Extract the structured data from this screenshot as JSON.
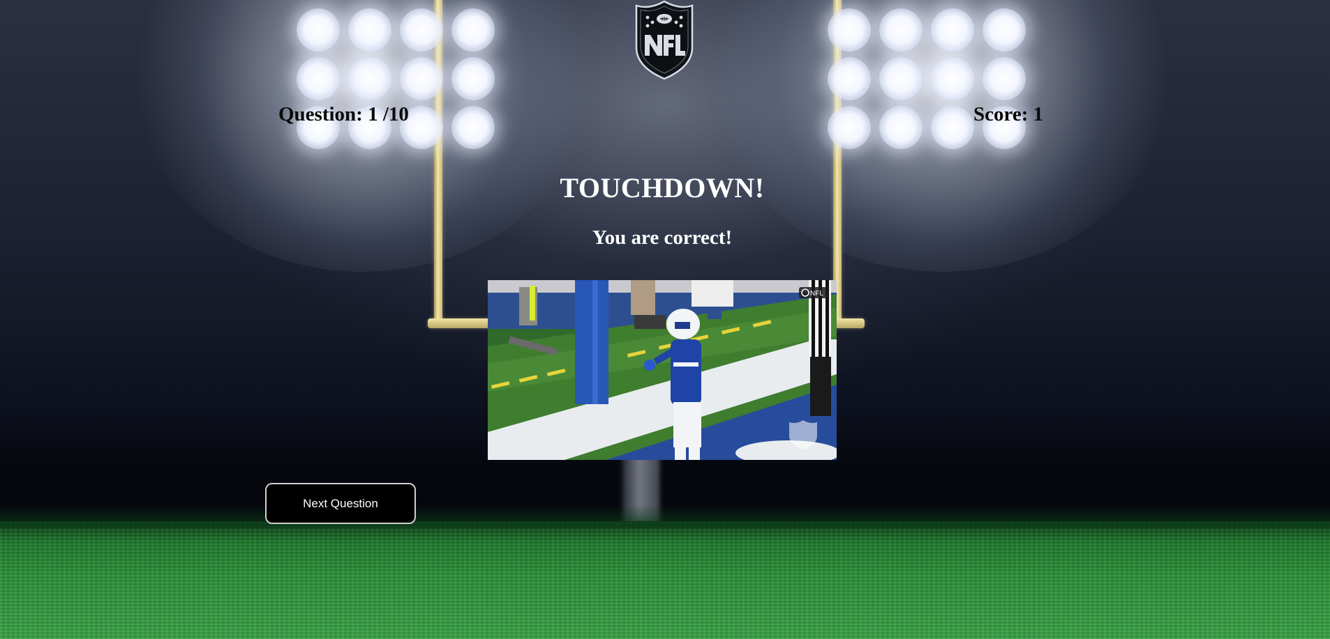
{
  "header": {
    "logo_icon": "nfl-shield-logo-icon",
    "question_text": "Question: 1 /10",
    "score_text": "Score: 1"
  },
  "result": {
    "title": "TOUCHDOWN!",
    "message": "You are correct!"
  },
  "media": {
    "description_icon": "touchdown-celebration-gif",
    "watermark_top": "NFL"
  },
  "actions": {
    "next_label": "Next Question"
  },
  "colors": {
    "button_background": "#000000",
    "button_border": "#d0d0d0",
    "title_text": "#ffffff",
    "counter_text": "#0a0a0a",
    "turf_green": "#2c9238"
  }
}
